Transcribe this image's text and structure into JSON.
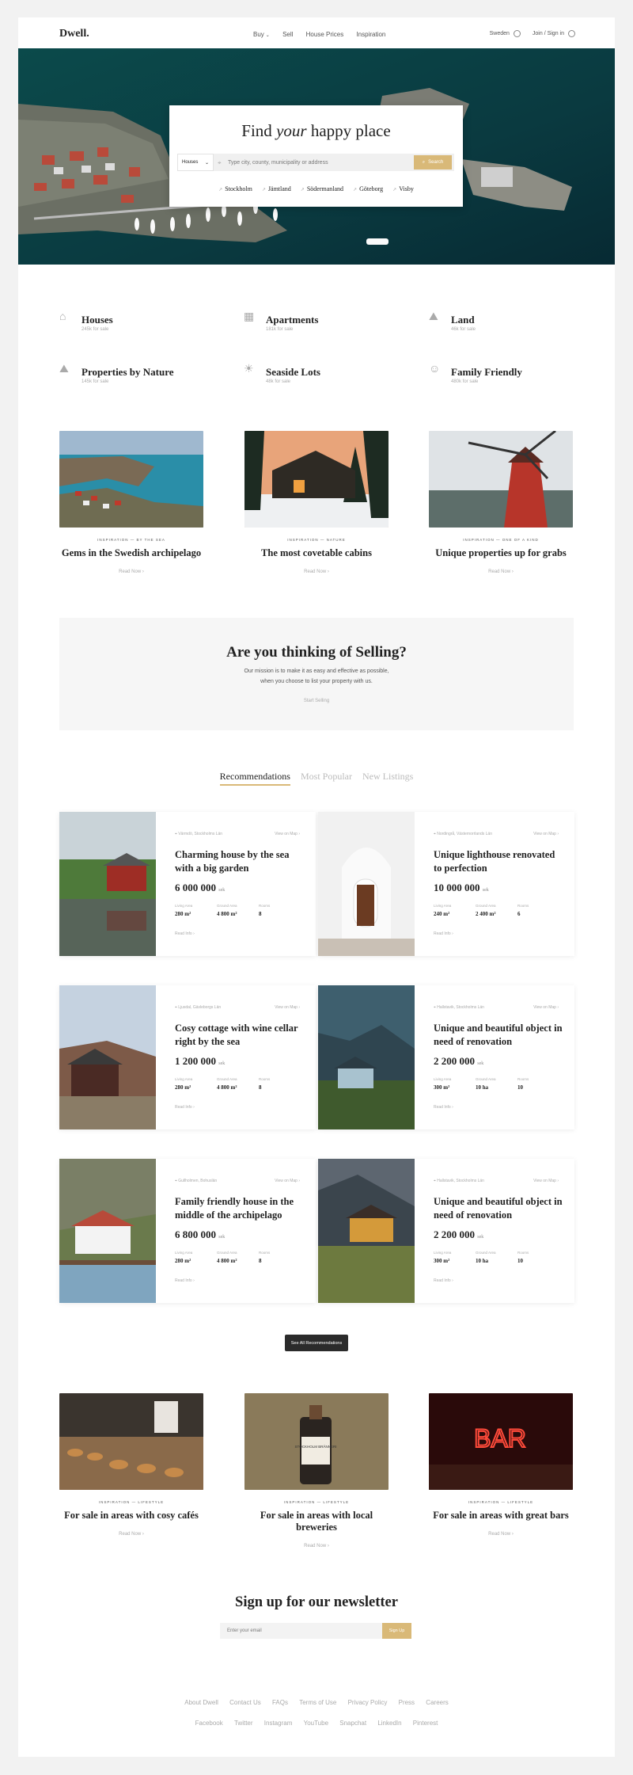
{
  "header": {
    "logo": "Dwell.",
    "nav": [
      "Buy",
      "Sell",
      "House Prices",
      "Inspiration"
    ],
    "country": "Sweden",
    "account": "Join / Sign in"
  },
  "hero": {
    "title_pre": "Find ",
    "title_em": "your",
    "title_post": " happy place",
    "select_value": "Houses",
    "search_placeholder": "Type city, county, municipality or address",
    "search_button": "Search",
    "cities": [
      "Stockholm",
      "Jämtland",
      "Södermanland",
      "Göteborg",
      "Visby"
    ]
  },
  "categories": [
    {
      "title": "Houses",
      "sub": "245k for sale",
      "icon": "house-icon"
    },
    {
      "title": "Apartments",
      "sub": "181k for sale",
      "icon": "building-icon"
    },
    {
      "title": "Land",
      "sub": "46k for sale",
      "icon": "landscape-icon"
    },
    {
      "title": "Properties by Nature",
      "sub": "145k for sale",
      "icon": "nature-icon"
    },
    {
      "title": "Seaside Lots",
      "sub": "48k for sale",
      "icon": "sun-icon"
    },
    {
      "title": "Family Friendly",
      "sub": "480k for sale",
      "icon": "family-icon"
    }
  ],
  "inspiration": [
    {
      "kicker": "Inspiration — By the sea",
      "title": "Gems in the Swedish archipelago",
      "link": "Read Now"
    },
    {
      "kicker": "Inspiration — Nature",
      "title": "The most covetable cabins",
      "link": "Read Now"
    },
    {
      "kicker": "Inspiration — One of a kind",
      "title": "Unique properties up for grabs",
      "link": "Read Now"
    }
  ],
  "selling": {
    "title": "Are you thinking of Selling?",
    "line1": "Our mission is to make it as easy and effective as possible,",
    "line2": "when you choose to list your property with us.",
    "link": "Start Selling"
  },
  "tabs": [
    "Recommendations",
    "Most Popular",
    "New Listings"
  ],
  "listings": [
    {
      "loc": "Värmdö, Stockholms Län",
      "map": "View on Map",
      "title": "Charming house by the sea with a big garden",
      "price": "6 000 000",
      "currency": "sek",
      "l1": "Living Area",
      "v1": "280 m²",
      "l2": "Ground Area",
      "v2": "4 800 m²",
      "l3": "Rooms",
      "v3": "8",
      "more": "Read Info"
    },
    {
      "loc": "Nordingrå, Västernorrlands Län",
      "map": "View on Map",
      "title": "Unique lighthouse renovated to perfection",
      "price": "10 000 000",
      "currency": "sek",
      "l1": "Living Area",
      "v1": "240 m²",
      "l2": "Ground Area",
      "v2": "2 400 m²",
      "l3": "Rooms",
      "v3": "6",
      "more": "Read Info"
    },
    {
      "loc": "Ljusdal, Gävleborgs Län",
      "map": "View on Map",
      "title": "Cosy cottage with wine cellar right by the sea",
      "price": "1 200 000",
      "currency": "sek",
      "l1": "Living Area",
      "v1": "280 m²",
      "l2": "Ground Area",
      "v2": "4 800 m²",
      "l3": "Rooms",
      "v3": "8",
      "more": "Read Info"
    },
    {
      "loc": "Hallstavik, Stockholms Län",
      "map": "View on Map",
      "title": "Unique and beautiful object in need of renovation",
      "price": "2 200 000",
      "currency": "sek",
      "l1": "Living Area",
      "v1": "300 m²",
      "l2": "Ground Area",
      "v2": "10 ha",
      "l3": "Rooms",
      "v3": "10",
      "more": "Read Info"
    },
    {
      "loc": "Gullholmen, Bohuslän",
      "map": "View on Map",
      "title": "Family friendly house in the middle of the archipelago",
      "price": "6 800 000",
      "currency": "sek",
      "l1": "Living Area",
      "v1": "280 m²",
      "l2": "Ground Area",
      "v2": "4 800 m²",
      "l3": "Rooms",
      "v3": "8",
      "more": "Read Info"
    },
    {
      "loc": "Hallstavik, Stockholms Län",
      "map": "View on Map",
      "title": "Unique and beautiful object in need of renovation",
      "price": "2 200 000",
      "currency": "sek",
      "l1": "Living Area",
      "v1": "300 m²",
      "l2": "Ground Area",
      "v2": "10 ha",
      "l3": "Rooms",
      "v3": "10",
      "more": "Read Info"
    }
  ],
  "see_all": "See All Recommendations",
  "lifestyle": [
    {
      "kicker": "Inspiration — Lifestyle",
      "title": "For sale in areas with cosy cafés",
      "link": "Read Now"
    },
    {
      "kicker": "Inspiration — Lifestyle",
      "title": "For sale in areas with local breweries",
      "link": "Read Now"
    },
    {
      "kicker": "Inspiration — Lifestyle",
      "title": "For sale in areas with great bars",
      "link": "Read Now"
    }
  ],
  "bottle_label": "STOCKHOLM BRÄNNERI",
  "bar_sign": "BAR",
  "newsletter": {
    "title": "Sign up for our newsletter",
    "placeholder": "Enter your email",
    "button": "Sign Up"
  },
  "footer": {
    "links": [
      "About Dwell",
      "Contact Us",
      "FAQs",
      "Terms of Use",
      "Privacy Policy",
      "Press",
      "Careers"
    ],
    "social": [
      "Facebook",
      "Twitter",
      "Instagram",
      "YouTube",
      "Snapchat",
      "LinkedIn",
      "Pinterest"
    ]
  },
  "colors": {
    "accent": "#d9b978",
    "dark": "#2b2b2b",
    "panel": "#f6f6f6"
  }
}
